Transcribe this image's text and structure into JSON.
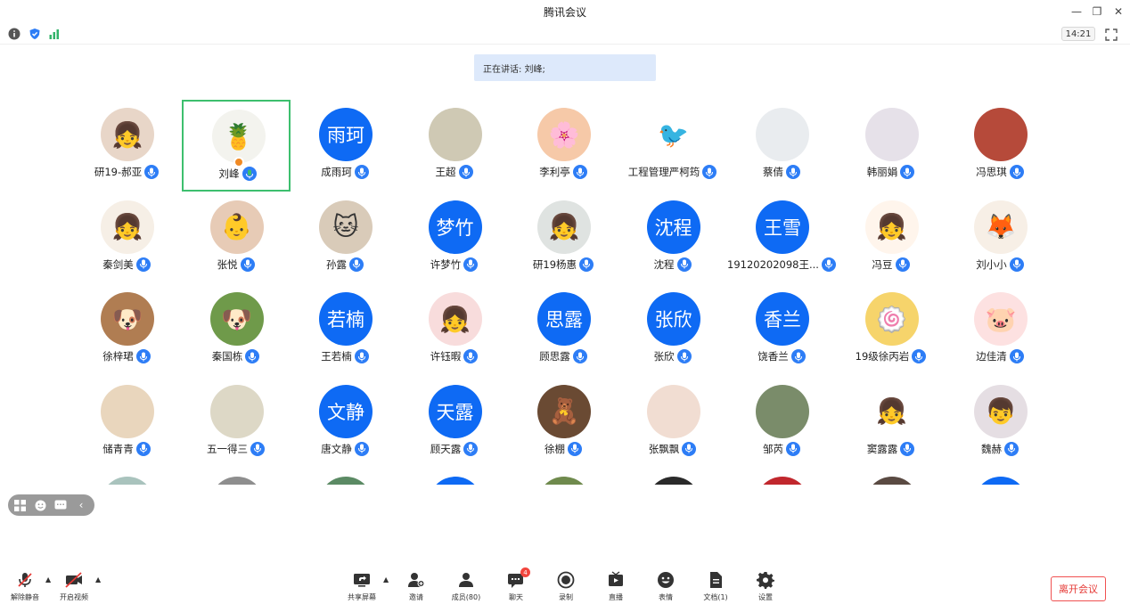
{
  "window": {
    "title": "腾讯会议"
  },
  "status": {
    "time": "14:21"
  },
  "speaking": {
    "text": "正在讲话: 刘峰;"
  },
  "participants": [
    {
      "name": "研19-郝亚",
      "avatar_text": "",
      "avatar_color": "#e8d6c8",
      "icon": "cartoon-girl-icon"
    },
    {
      "name": "刘峰",
      "avatar_text": "",
      "avatar_color": "#f3f3ee",
      "icon": "pineapple-icon",
      "active": true
    },
    {
      "name": "成雨珂",
      "avatar_text": "雨珂",
      "avatar_color": "#0e6af4",
      "icon": ""
    },
    {
      "name": "王超",
      "avatar_text": "",
      "avatar_color": "#cfc9b4",
      "icon": "photo-icon"
    },
    {
      "name": "李利亭",
      "avatar_text": "",
      "avatar_color": "#f6c9a8",
      "icon": "flower-icon"
    },
    {
      "name": "工程管理严柯筠",
      "avatar_text": "",
      "avatar_color": "#ffffff",
      "icon": "angry-bird-icon"
    },
    {
      "name": "蔡倩",
      "avatar_text": "",
      "avatar_color": "#e9ecef",
      "icon": "photo-icon"
    },
    {
      "name": "韩丽娟",
      "avatar_text": "",
      "avatar_color": "#e6e1e9",
      "icon": "photo-icon"
    },
    {
      "name": "冯思琪",
      "avatar_text": "",
      "avatar_color": "#b64a3a",
      "icon": "photo-icon"
    },
    {
      "name": "秦剑美",
      "avatar_text": "",
      "avatar_color": "#f6efe6",
      "icon": "cartoon-girl-icon"
    },
    {
      "name": "张悦",
      "avatar_text": "",
      "avatar_color": "#e7cbb6",
      "icon": "baby-photo-icon"
    },
    {
      "name": "孙露",
      "avatar_text": "",
      "avatar_color": "#d9cbb9",
      "icon": "cat-icon"
    },
    {
      "name": "许梦竹",
      "avatar_text": "梦竹",
      "avatar_color": "#0e6af4",
      "icon": ""
    },
    {
      "name": "研19杨惠",
      "avatar_text": "",
      "avatar_color": "#dfe3e1",
      "icon": "cartoon-girl-icon"
    },
    {
      "name": "沈程",
      "avatar_text": "沈程",
      "avatar_color": "#0e6af4",
      "icon": ""
    },
    {
      "name": "19120202098王...",
      "avatar_text": "王雪",
      "avatar_color": "#0e6af4",
      "icon": ""
    },
    {
      "name": "冯豆",
      "avatar_text": "",
      "avatar_color": "#fff5ec",
      "icon": "cartoon-girl-icon"
    },
    {
      "name": "刘小小",
      "avatar_text": "",
      "avatar_color": "#f7efe6",
      "icon": "fox-icon"
    },
    {
      "name": "徐梓珺",
      "avatar_text": "",
      "avatar_color": "#b07d52",
      "icon": "dog-photo-icon"
    },
    {
      "name": "秦国栋",
      "avatar_text": "",
      "avatar_color": "#6f9a4a",
      "icon": "dog-photo-icon"
    },
    {
      "name": "王若楠",
      "avatar_text": "若楠",
      "avatar_color": "#0e6af4",
      "icon": ""
    },
    {
      "name": "许钰暇",
      "avatar_text": "",
      "avatar_color": "#f8dcdc",
      "icon": "cartoon-girl-icon"
    },
    {
      "name": "顾思露",
      "avatar_text": "思露",
      "avatar_color": "#0e6af4",
      "icon": ""
    },
    {
      "name": "张欣",
      "avatar_text": "张欣",
      "avatar_color": "#0e6af4",
      "icon": ""
    },
    {
      "name": "饶香兰",
      "avatar_text": "香兰",
      "avatar_color": "#0e6af4",
      "icon": ""
    },
    {
      "name": "19级徐丙岩",
      "avatar_text": "",
      "avatar_color": "#f6d46b",
      "icon": "naruto-icon"
    },
    {
      "name": "边佳清",
      "avatar_text": "",
      "avatar_color": "#fde1e1",
      "icon": "pig-icon"
    },
    {
      "name": "储青青",
      "avatar_text": "",
      "avatar_color": "#e9d6bd",
      "icon": "photo-icon"
    },
    {
      "name": "五一得三",
      "avatar_text": "",
      "avatar_color": "#ddd8c6",
      "icon": "photo-icon"
    },
    {
      "name": "唐文静",
      "avatar_text": "文静",
      "avatar_color": "#0e6af4",
      "icon": ""
    },
    {
      "name": "顾天露",
      "avatar_text": "天露",
      "avatar_color": "#0e6af4",
      "icon": ""
    },
    {
      "name": "徐棚",
      "avatar_text": "",
      "avatar_color": "#6a4a33",
      "icon": "bear-icon"
    },
    {
      "name": "张飘飘",
      "avatar_text": "",
      "avatar_color": "#f1ddd2",
      "icon": "photo-icon"
    },
    {
      "name": "邹芮",
      "avatar_text": "",
      "avatar_color": "#7a8c6a",
      "icon": "photo-icon"
    },
    {
      "name": "窦露露",
      "avatar_text": "",
      "avatar_color": "#ffffff",
      "icon": "cartoon-girl-icon"
    },
    {
      "name": "魏赫",
      "avatar_text": "",
      "avatar_color": "#e5dee3",
      "icon": "anime-boy-icon"
    },
    {
      "name": "",
      "avatar_text": "",
      "avatar_color": "#a9c3bd",
      "icon": "photo-icon"
    },
    {
      "name": "",
      "avatar_text": "",
      "avatar_color": "#8e8e8e",
      "icon": "photo-icon"
    },
    {
      "name": "",
      "avatar_text": "",
      "avatar_color": "#5b8a64",
      "icon": "photo-icon"
    },
    {
      "name": "",
      "avatar_text": "",
      "avatar_color": "#0e6af4",
      "icon": ""
    },
    {
      "name": "",
      "avatar_text": "",
      "avatar_color": "#6f8a4d",
      "icon": "photo-icon"
    },
    {
      "name": "",
      "avatar_text": "",
      "avatar_color": "#2a2a2a",
      "icon": "photo-icon"
    },
    {
      "name": "",
      "avatar_text": "",
      "avatar_color": "#c1272d",
      "icon": "photo-icon"
    },
    {
      "name": "",
      "avatar_text": "",
      "avatar_color": "#5a4a42",
      "icon": "photo-icon"
    },
    {
      "name": "",
      "avatar_text": "",
      "avatar_color": "#0e6af4",
      "icon": ""
    }
  ],
  "toolbar": {
    "unmute": "解除静音",
    "start_video": "开启视频",
    "share_screen": "共享屏幕",
    "invite": "邀请",
    "members": "成员(80)",
    "chat": "聊天",
    "chat_badge": "4",
    "record": "录制",
    "live": "直播",
    "reactions": "表情",
    "docs": "文档(1)",
    "settings": "设置",
    "leave": "离开会议"
  },
  "colors": {
    "accent": "#0e6af4",
    "active_border": "#3dbf6e",
    "leave": "#e53935"
  }
}
